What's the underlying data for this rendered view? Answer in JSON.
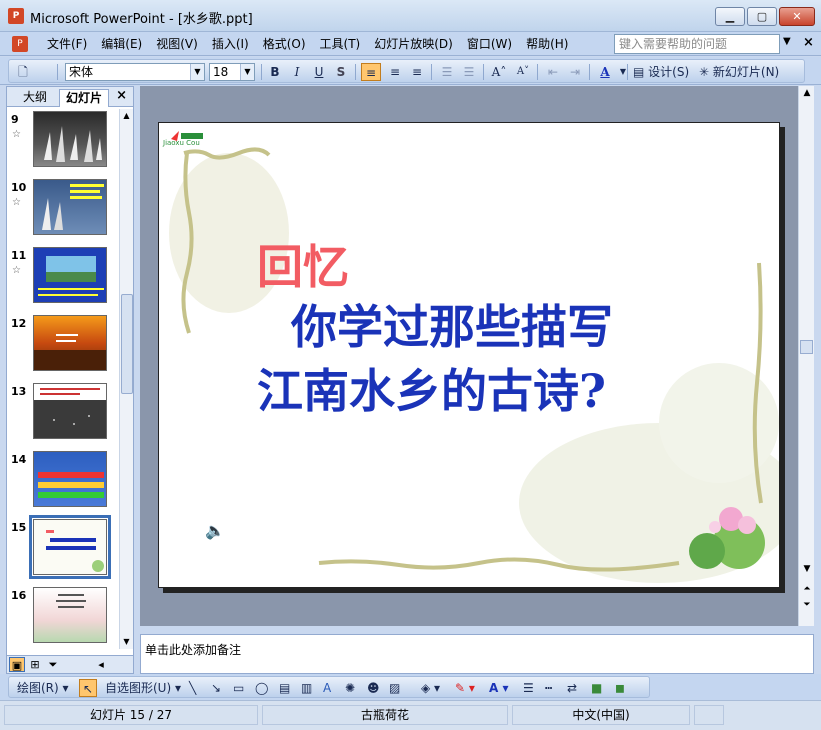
{
  "window": {
    "title": "Microsoft PowerPoint - [水乡歌.ppt]",
    "app_icon": "P",
    "buttons": [
      "▁",
      "▢",
      "✕"
    ]
  },
  "menubar": {
    "items": [
      "文件(F)",
      "编辑(E)",
      "视图(V)",
      "插入(I)",
      "格式(O)",
      "工具(T)",
      "幻灯片放映(D)",
      "窗口(W)",
      "帮助(H)"
    ],
    "help_placeholder": "键入需要帮助的问题",
    "close_glyph": "×"
  },
  "toolbar": {
    "font_name": "宋体",
    "font_size": "18",
    "bold": "B",
    "italic": "I",
    "underline": "U",
    "shadow": "S",
    "design_label": "设计(S)",
    "new_slide_label": "新幻灯片(N)"
  },
  "leftpane": {
    "tab_outline": "大纲",
    "tab_slides": "幻灯片",
    "close_glyph": "×",
    "slides": [
      {
        "num": "9",
        "star": "☆",
        "selected": false
      },
      {
        "num": "10",
        "star": "☆",
        "selected": false
      },
      {
        "num": "11",
        "star": "☆",
        "selected": false
      },
      {
        "num": "12",
        "star": "",
        "selected": false
      },
      {
        "num": "13",
        "star": "",
        "selected": false
      },
      {
        "num": "14",
        "star": "",
        "selected": false
      },
      {
        "num": "15",
        "star": "",
        "selected": true
      },
      {
        "num": "16",
        "star": "",
        "selected": false
      }
    ]
  },
  "slide": {
    "title": "回忆",
    "line1": "你学过那些描写",
    "line2": "江南水乡的古诗?",
    "logo_text": "Jiaoxu Cou",
    "colors": {
      "title": "#f25c63",
      "body": "#1a33b8"
    }
  },
  "notes": {
    "placeholder": "单击此处添加备注"
  },
  "drawbar": {
    "draw_label": "绘图(R)",
    "autoshapes_label": "自选图形(U)"
  },
  "statusbar": {
    "slide_info": "幻灯片 15 / 27",
    "design": "古瓶荷花",
    "language": "中文(中国)"
  }
}
